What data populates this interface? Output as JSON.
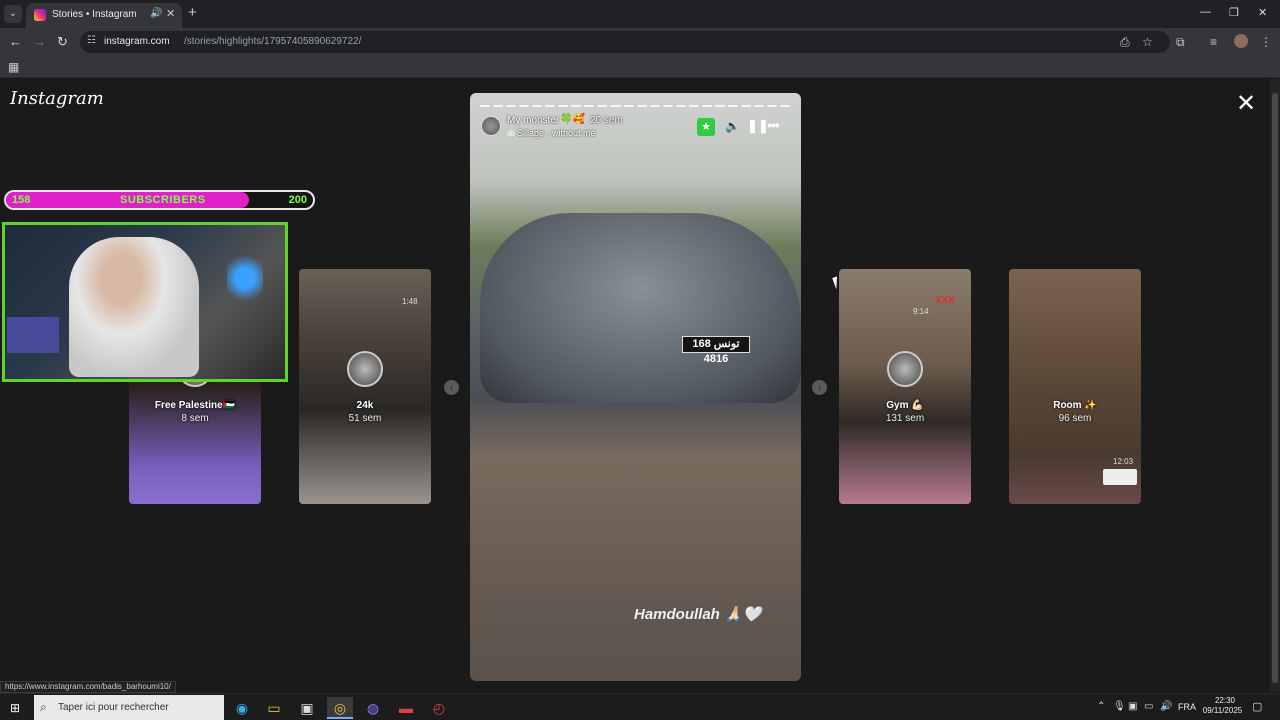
{
  "browser": {
    "tab_title": "Stories • Instagram",
    "url_host": "instagram.com",
    "url_path": "/stories/highlights/17957405890629722/",
    "status_url": "https://www.instagram.com/badis_barhoumi10/"
  },
  "page": {
    "logo": "Instagram",
    "prev_arrow": "‹",
    "next_arrow": "›"
  },
  "side_stories": [
    {
      "name": "Free Palestine🇵🇸",
      "age": "8 sem"
    },
    {
      "name": "24k",
      "age": "51 sem",
      "time": "1:48"
    },
    {
      "name": "Gym 💪🏻",
      "age": "131 sem",
      "time": "9:14",
      "tag": "XXX"
    },
    {
      "name": "Room ✨",
      "age": "96 sem",
      "time": "12:03"
    }
  ],
  "active_story": {
    "progress_total": 24,
    "progress_done": 24,
    "username": "My monster",
    "username_emoji": "🍀🥰",
    "age": "20 sem",
    "music": "Sillage · without me",
    "plate": "168 تونس 4816",
    "caption": "Hamdoullah 🙏🏻🤍"
  },
  "overlay": {
    "sub_current": "158",
    "sub_label": "SUBSCRIBERS",
    "sub_goal": "200",
    "sub_progress": 0.79
  },
  "taskbar": {
    "search_placeholder": "Taper ici pour rechercher",
    "lang": "FRA",
    "time": "22:30",
    "date": "09/11/2025"
  },
  "colors": {
    "sub_fill": "#e020c8",
    "sub_text": "#7dff4a",
    "webcam_border": "#5fd42a",
    "star_button": "#2ecc40"
  }
}
